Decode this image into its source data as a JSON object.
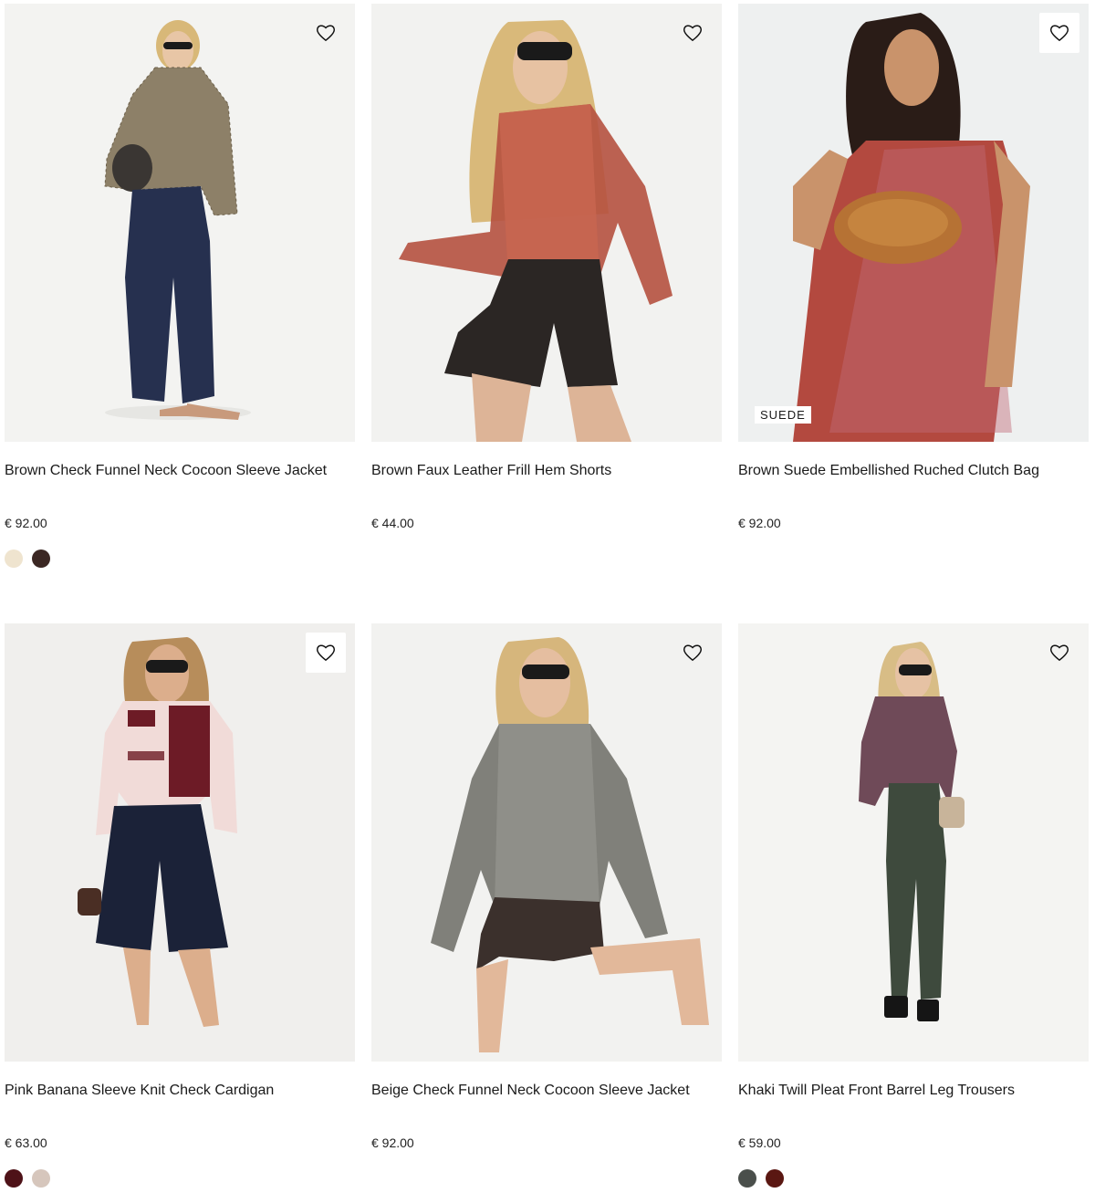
{
  "products": [
    {
      "title": "Brown Check Funnel Neck Cocoon Sleeve Jacket",
      "price": "€ 92.00",
      "swatches": [
        "#efe4cf",
        "#3b2723"
      ]
    },
    {
      "title": "Brown Faux Leather Frill Hem Shorts",
      "price": "€ 44.00",
      "swatches": []
    },
    {
      "title": "Brown Suede Embellished Ruched Clutch Bag",
      "price": "€ 92.00",
      "badge": "SUEDE",
      "swatches": []
    },
    {
      "title": "Pink Banana Sleeve Knit Check Cardigan",
      "price": "€ 63.00",
      "swatches": [
        "#4e1218",
        "#d6c6bc"
      ]
    },
    {
      "title": "Beige Check Funnel Neck Cocoon Sleeve Jacket",
      "price": "€ 92.00",
      "swatches": []
    },
    {
      "title": "Khaki Twill Pleat Front Barrel Leg Trousers",
      "price": "€ 59.00",
      "swatches": [
        "#4a4f4b",
        "#5a1712"
      ]
    }
  ],
  "icons": {
    "wishlist": "heart-outline-icon"
  }
}
